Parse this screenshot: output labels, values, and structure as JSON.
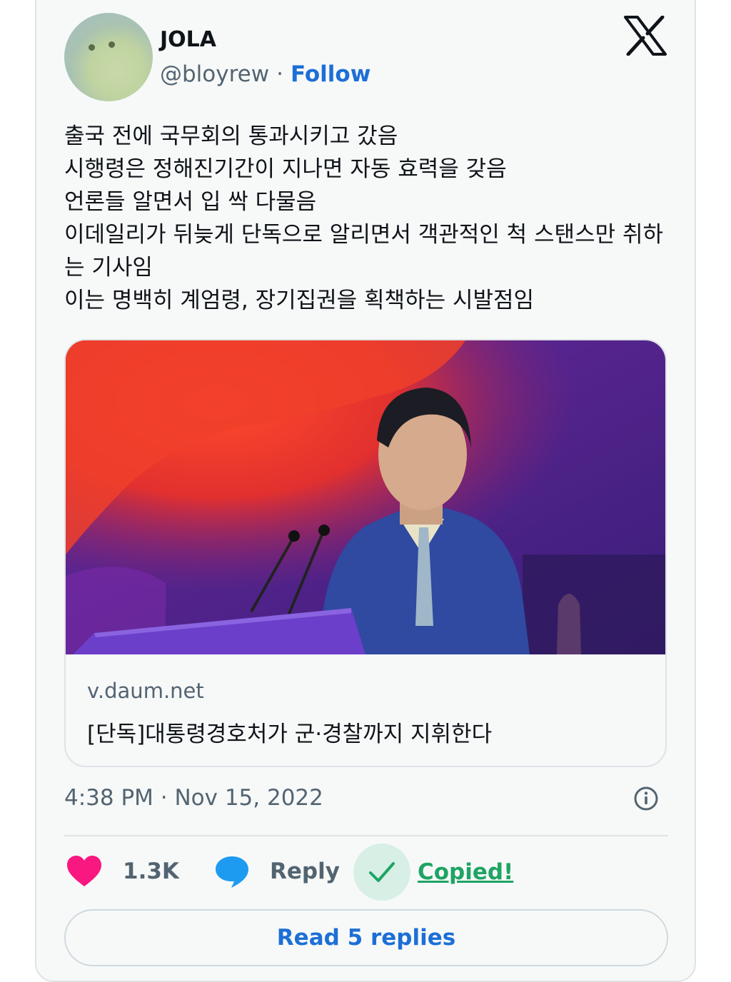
{
  "author": {
    "name": "JOLA",
    "handle": "@bloyrew",
    "separator": "·",
    "follow_label": "Follow"
  },
  "platform_icon": "x-logo-icon",
  "tweet": {
    "lines": [
      "출국 전에 국무회의 통과시키고 갔음",
      "시행령은 정해진기간이 지나면 자동 효력을 갖음",
      "언론들 알면서 입 싹 다물음",
      "이데일리가 뒤늦게 단독으로 알리면서 객관적인 척 스탠스만 취하",
      "는 기사임",
      "이는 명백히 계엄령, 장기집권을 획책하는 시발점임"
    ]
  },
  "link_card": {
    "domain": "v.daum.net",
    "title": "[단독]대통령경호처가 군·경찰까지 지휘한다"
  },
  "timestamp": "4:38 PM · Nov 15, 2022",
  "actions": {
    "like_count": "1.3K",
    "reply_label": "Reply",
    "copied_label": "Copied!"
  },
  "read_replies_label": "Read 5 replies",
  "colors": {
    "accent": "#1d6fd6",
    "like": "#f91880",
    "reply": "#1d9bf0",
    "copied": "#1fa463"
  }
}
